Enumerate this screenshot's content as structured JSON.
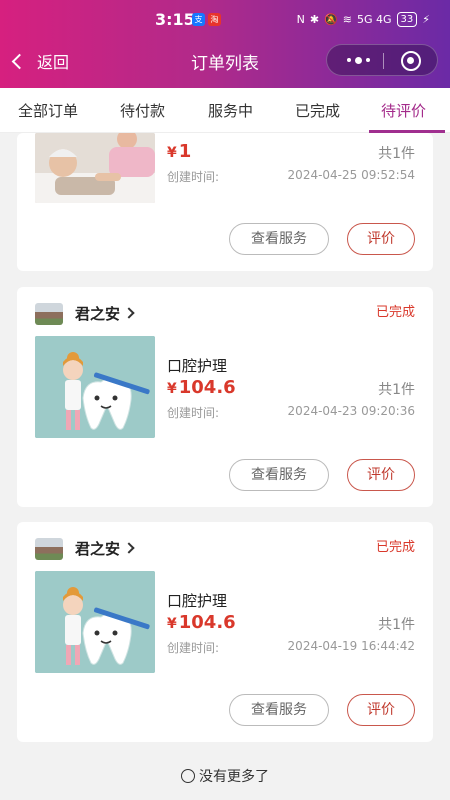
{
  "status_bar": {
    "time": "3:15",
    "app_badges": [
      "支",
      "淘"
    ],
    "signal_text": "5G 4G",
    "battery": "33"
  },
  "nav": {
    "back_label": "返回",
    "title": "订单列表"
  },
  "tabs": [
    {
      "label": "全部订单",
      "active": false
    },
    {
      "label": "待付款",
      "active": false
    },
    {
      "label": "服务中",
      "active": false
    },
    {
      "label": "已完成",
      "active": false
    },
    {
      "label": "待评价",
      "active": true
    }
  ],
  "orders": [
    {
      "shop_name": "",
      "status": "",
      "product_name": "",
      "price_symbol": "¥",
      "price": "1",
      "quantity": "共1件",
      "created_label": "创建时间:",
      "created_at": "2024-04-25 09:52:54",
      "view_button": "查看服务",
      "rate_button": "评价",
      "image": "elderly-care-photo"
    },
    {
      "shop_name": "君之安",
      "status": "已完成",
      "product_name": "口腔护理",
      "price_symbol": "¥",
      "price": "104.6",
      "quantity": "共1件",
      "created_label": "创建时间:",
      "created_at": "2024-04-23 09:20:36",
      "view_button": "查看服务",
      "rate_button": "评价",
      "image": "tooth-cartoon"
    },
    {
      "shop_name": "君之安",
      "status": "已完成",
      "product_name": "口腔护理",
      "price_symbol": "¥",
      "price": "104.6",
      "quantity": "共1件",
      "created_label": "创建时间:",
      "created_at": "2024-04-19 16:44:42",
      "view_button": "查看服务",
      "rate_button": "评价",
      "image": "tooth-cartoon"
    }
  ],
  "footer": {
    "text": "没有更多了"
  },
  "colors": {
    "accent": "#a32a8a",
    "price": "#d9382b"
  }
}
